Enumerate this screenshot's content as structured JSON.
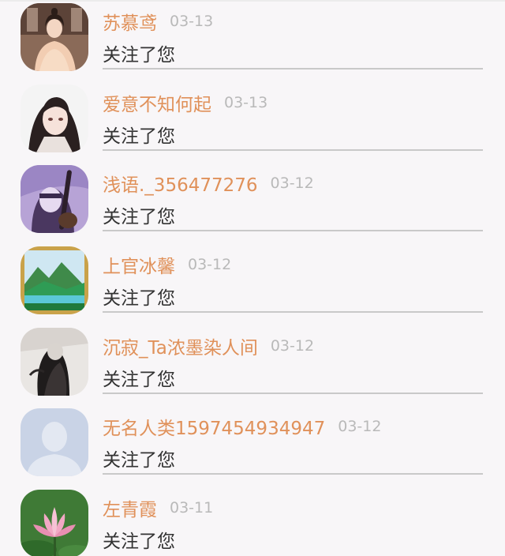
{
  "notifications": [
    {
      "name": "苏慕鸢",
      "date": "03-13",
      "action": "关注了您",
      "avatar_icon": "avatar-woman-hanfu"
    },
    {
      "name": "爱意不知何起",
      "date": "03-13",
      "action": "关注了您",
      "avatar_icon": "avatar-anime-man"
    },
    {
      "name": "浅语._356477276",
      "date": "03-12",
      "action": "关注了您",
      "avatar_icon": "avatar-anime-girl-instrument"
    },
    {
      "name": "上官冰馨",
      "date": "03-12",
      "action": "关注了您",
      "avatar_icon": "avatar-landscape"
    },
    {
      "name": "沉寂_Ta浓墨染人间",
      "date": "03-12",
      "action": "关注了您",
      "avatar_icon": "avatar-ink-painting"
    },
    {
      "name": "无名人类1597454934947",
      "date": "03-12",
      "action": "关注了您",
      "avatar_icon": "avatar-default-silhouette"
    },
    {
      "name": "左青霞",
      "date": "03-11",
      "action": "关注了您",
      "avatar_icon": "avatar-lotus-flower"
    }
  ],
  "colors": {
    "name": "#e0915a",
    "date": "#b9b9b9",
    "action": "#333333",
    "background": "#f8f6f8",
    "divider": "#c9c9c9"
  }
}
